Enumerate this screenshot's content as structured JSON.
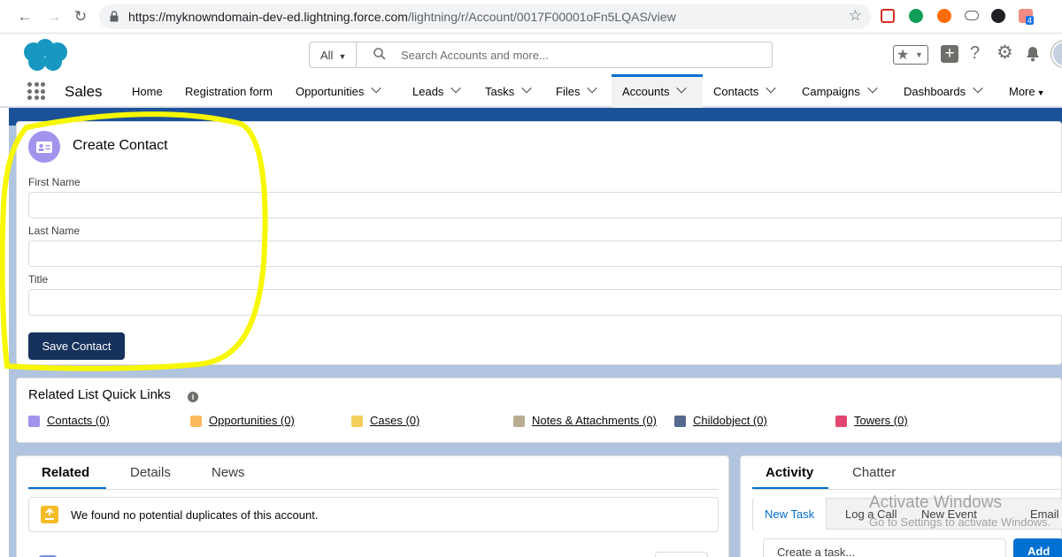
{
  "browser": {
    "url_host": "https://myknowndomain-dev-ed.lightning.force.com",
    "url_path": "/lightning/r/Account/0017F00001oFn5LQAS/view",
    "ext_badge": "4"
  },
  "header": {
    "search_scope": "All",
    "search_placeholder": "Search Accounts and more..."
  },
  "nav": {
    "app_name": "Sales",
    "items": [
      {
        "label": "Home"
      },
      {
        "label": "Registration form"
      },
      {
        "label": "Opportunities"
      },
      {
        "label": "Leads"
      },
      {
        "label": "Tasks"
      },
      {
        "label": "Files"
      },
      {
        "label": "Accounts"
      },
      {
        "label": "Contacts"
      },
      {
        "label": "Campaigns"
      },
      {
        "label": "Dashboards"
      },
      {
        "label": "More"
      }
    ],
    "active": "Accounts"
  },
  "create_contact": {
    "title": "Create Contact",
    "first_name_label": "First Name",
    "last_name_label": "Last Name",
    "title_label": "Title",
    "first_name_value": "",
    "last_name_value": "",
    "title_value": "",
    "save_label": "Save Contact"
  },
  "quick_links": {
    "title": "Related List Quick Links",
    "info": "i",
    "links": [
      {
        "label": "Contacts (0)",
        "color": "#a094ed"
      },
      {
        "label": "Opportunities (0)",
        "color": "#fcb95b"
      },
      {
        "label": "Cases (0)",
        "color": "#f2cf5b"
      },
      {
        "label": "Notes & Attachments (0)",
        "color": "#baac93"
      },
      {
        "label": "Childobject (0)",
        "color": "#54698d"
      },
      {
        "label": "Towers (0)",
        "color": "#e3466e"
      }
    ]
  },
  "related": {
    "tabs": [
      "Related",
      "Details",
      "News"
    ],
    "duplicate_message": "We found no potential duplicates of this account."
  },
  "activity": {
    "tabs": [
      "Activity",
      "Chatter"
    ],
    "actions": [
      "New Task",
      "Log a Call",
      "New Event",
      "Email"
    ],
    "task_placeholder": "Create a task...",
    "add_label": "Add"
  },
  "watermark": {
    "line1": "Activate Windows",
    "line2": "Go to Settings to activate Windows."
  },
  "colors": {
    "brand_blue": "#0070d2",
    "save_button": "#16325c",
    "annotation": "#f7f700"
  }
}
